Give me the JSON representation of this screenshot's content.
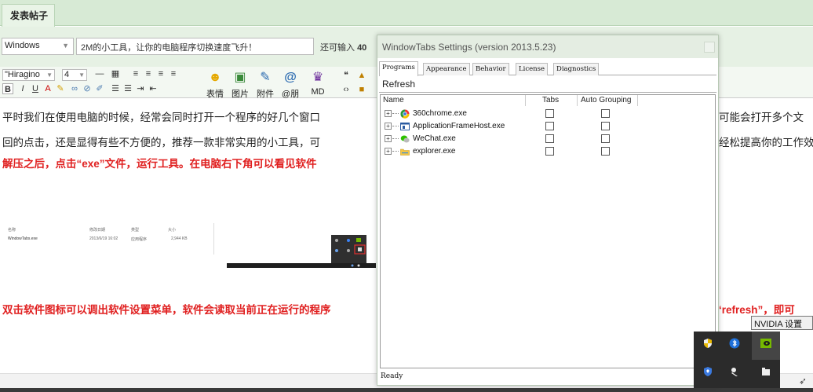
{
  "editor": {
    "tab_label": "发表帖子",
    "category": "Windows",
    "title_value": "2M的小工具，让你的电脑程序切换速度飞升！",
    "char_remaining_prefix": "还可输入",
    "char_remaining_count": "40",
    "font_family": "\"Hiragino",
    "font_size": "4",
    "toolbar": {
      "emoji_label": "表情",
      "image_label": "图片",
      "attachment_label": "附件",
      "mention_label": "@朋",
      "md_label": "MD"
    },
    "content": {
      "para1_left": "平时我们在使用电脑的时候，经常会同时打开一个程序的好几个窗口",
      "para1_right": "可能会打开多个文",
      "para2_left": "回的点击，还是显得有些不方便的，推荐一款非常实用的小工具，可",
      "para2_right": "经松提高你的工作效",
      "red1_left": "解压之后，点击“exe”文件，运行工具。在电脑右下角可以看见软件",
      "red2_left": "双击软件图标可以调出软件设置菜单，软件会读取当前正在运行的程序",
      "red2_right": "‘refresh”，即可"
    },
    "explorer_shot": {
      "col_name": "名称",
      "col_date": "修改日期",
      "col_type": "类型",
      "col_size": "大小",
      "file_name": "WindowTabs.exe",
      "file_date": "2013/6/19 16:02",
      "file_type": "应用程序",
      "file_size": "2,944 KB"
    }
  },
  "dialog": {
    "title": "WindowTabs Settings (version 2013.5.23)",
    "tabs": [
      "Programs",
      "Appearance",
      "Behavior",
      "License",
      "Diagnostics"
    ],
    "refresh_label": "Refresh",
    "columns": {
      "name": "Name",
      "tabs": "Tabs",
      "auto_grouping": "Auto Grouping"
    },
    "programs": [
      {
        "name": "360chrome.exe",
        "icon": "chrome-icon"
      },
      {
        "name": "ApplicationFrameHost.exe",
        "icon": "window-icon"
      },
      {
        "name": "WeChat.exe",
        "icon": "wechat-icon"
      },
      {
        "name": "explorer.exe",
        "icon": "folder-icon"
      }
    ],
    "status": "Ready"
  },
  "tray": {
    "tooltip": "NVIDIA 设置"
  },
  "colors": {
    "accent_green": "#d7ead5",
    "warning_red": "#e02020",
    "tray_bg": "#2b2b2b"
  }
}
